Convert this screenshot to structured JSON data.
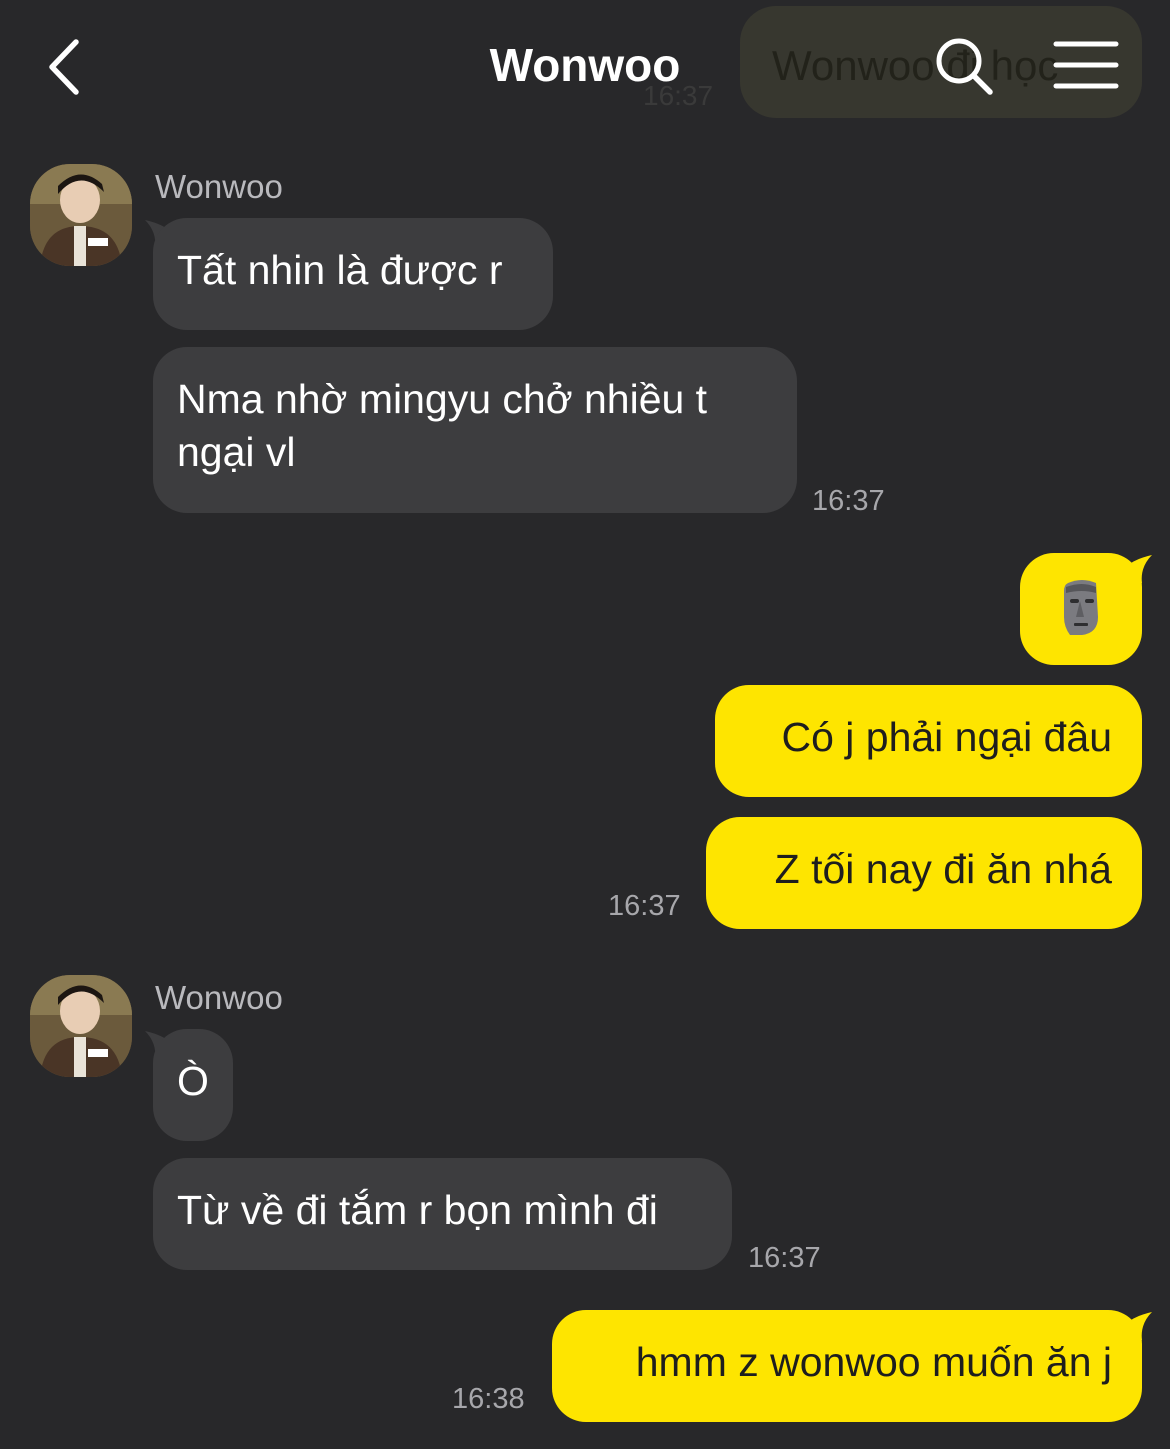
{
  "header": {
    "title": "Wonwoo",
    "back_icon": "chevron-left-icon",
    "search_icon": "search-icon",
    "menu_icon": "hamburger-menu-icon"
  },
  "ghost": {
    "text": "Wonwoo đi học",
    "time": "16:37"
  },
  "colors": {
    "background": "#28282a",
    "incoming_bubble": "#3d3d3f",
    "outgoing_bubble": "#fee500",
    "time_text": "#a7a7ab"
  },
  "messages": {
    "group1": {
      "sender": "Wonwoo",
      "m1": "Tất nhin là được r",
      "m2_line1": "Nma nhờ mingyu chở nhiều t",
      "m2_line2": "ngại vl",
      "time": "16:37"
    },
    "group2": {
      "sticker": "moai-emoji",
      "m1": "Có j phải ngại đâu",
      "m2": "Z tối nay đi ăn nhá",
      "time": "16:37"
    },
    "group3": {
      "sender": "Wonwoo",
      "m1": "Ò",
      "m2": "Từ về đi tắm r bọn mình đi",
      "time": "16:37"
    },
    "group4": {
      "m1": "hmm z wonwoo muốn ăn j",
      "time": "16:38"
    }
  }
}
